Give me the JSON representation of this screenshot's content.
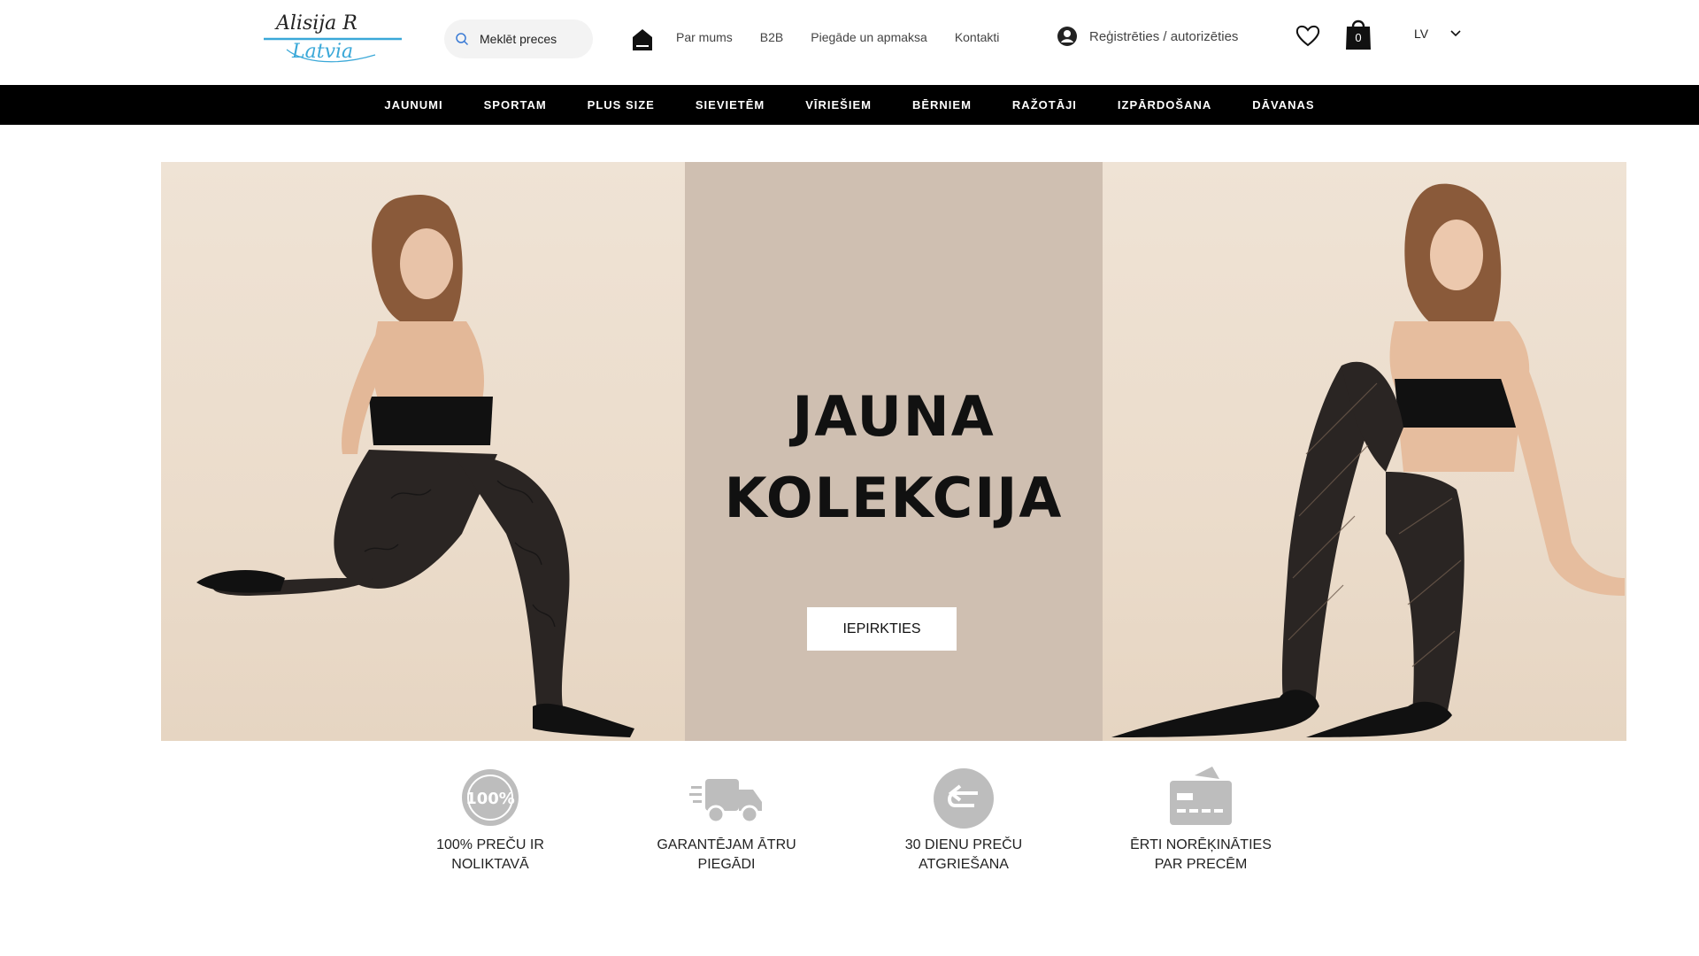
{
  "header": {
    "logo": {
      "line1": "Alisija R",
      "line2": "Latvia"
    },
    "search": {
      "placeholder": "Meklēt preces"
    },
    "links": [
      "Par mums",
      "B2B",
      "Piegāde un apmaksa",
      "Kontakti"
    ],
    "account_label": "Reģistrēties / autorizēties",
    "cart_count": "0",
    "language": "LV"
  },
  "nav": {
    "items": [
      "JAUNUMI",
      "SPORTAM",
      "PLUS SIZE",
      "SIEVIETĒM",
      "VĪRIEŠIEM",
      "BĒRNIEM",
      "RAŽOTĀJI",
      "IZPĀRDOŠANA",
      "DĀVANAS"
    ]
  },
  "hero": {
    "title_line1": "JAUNA",
    "title_line2": "KOLEKCIJA",
    "button_label": "IEPIRKTIES"
  },
  "features": [
    {
      "icon": "hundred-percent-badge-icon",
      "text": "100% PREČU IR\nNOLIKTAVĀ"
    },
    {
      "icon": "delivery-truck-icon",
      "text": "GARANTĒJAM ĀTRU\nPIEGĀDI"
    },
    {
      "icon": "return-arrow-icon",
      "text": "30 DIENU PREČU\nATGRIEŠANA"
    },
    {
      "icon": "credit-card-icon",
      "text": "ĒRTI NORĒĶINĀTIES\nPAR PRECĒM"
    }
  ],
  "colors": {
    "nav_bg": "#000000",
    "hero_center_bg": "#cfbfb1",
    "logo_accent": "#3aa8d8",
    "feature_icon": "#bdbdbd"
  }
}
